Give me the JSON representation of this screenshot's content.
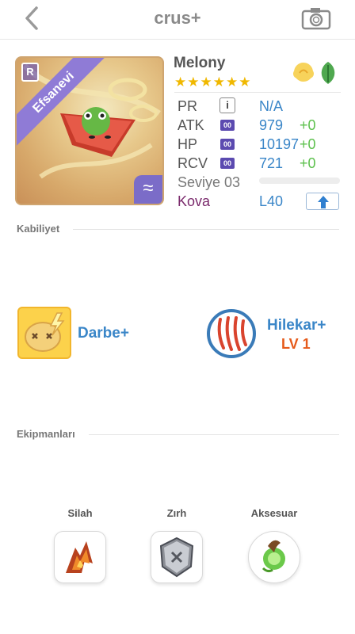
{
  "header": {
    "title": "crus+",
    "back_icon": "chevron-left-icon",
    "camera_icon": "camera-icon"
  },
  "card": {
    "ribbon": "Efsanevi",
    "rarity_badge": "R",
    "type_badge": "≈"
  },
  "monster": {
    "name": "Melony",
    "stars": "★★★★★★",
    "star_count": 6,
    "elements": [
      "light-element-icon",
      "wood-element-icon"
    ]
  },
  "stats": {
    "pr": {
      "label": "PR",
      "value": "N/A",
      "icon": "i"
    },
    "atk": {
      "label": "ATK",
      "icon": "00",
      "value": "979",
      "plus": "+0"
    },
    "hp": {
      "label": "HP",
      "icon": "00",
      "value": "10197",
      "plus": "+0"
    },
    "rcv": {
      "label": "RCV",
      "icon": "00",
      "value": "721",
      "plus": "+0"
    },
    "level": {
      "label": "Seviye 03",
      "progress": 0
    },
    "group": {
      "label": "Kova",
      "value": "L40"
    }
  },
  "abilities": {
    "title": "Kabiliyet",
    "leader": {
      "name": "Darbe+"
    },
    "active": {
      "name": "Hilekar+",
      "level": "LV 1"
    }
  },
  "equipment": {
    "title": "Ekipmanları",
    "slots": [
      {
        "label": "Silah"
      },
      {
        "label": "Zırh"
      },
      {
        "label": "Aksesuar"
      }
    ]
  },
  "colors": {
    "accent": "#3a86c8",
    "plus": "#5cc04c",
    "group": "#7a2a6c",
    "level": "#e65a1a"
  }
}
